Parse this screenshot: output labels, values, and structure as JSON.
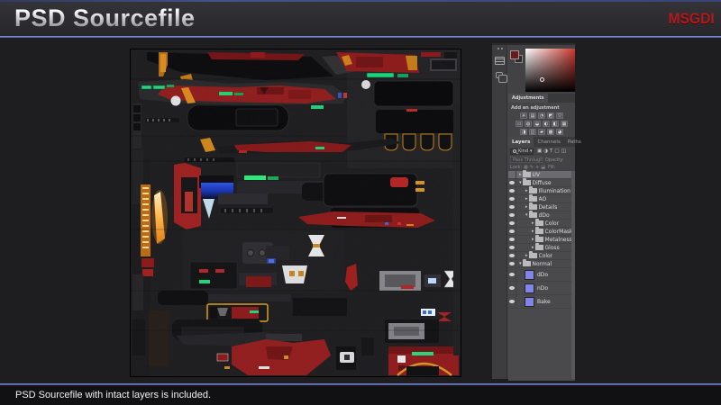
{
  "header": {
    "title": "PSD Sourcefile",
    "logo": "MSGDI"
  },
  "footer": {
    "caption": "PSD Sourcefile with intact layers is included."
  },
  "colors": {
    "accent_blue": "#5a6fc0",
    "logo_red": "#b01b1b",
    "layer_thumb_purple": "#8185e8",
    "picker_hue_red": "#c93a30",
    "slide_background": "#1e1e20"
  },
  "photoshop": {
    "adjustments": {
      "tab": "Adjustments",
      "label": "Add an adjustment",
      "icon_rows": [
        [
          "☀",
          "▤",
          "◔",
          "◩",
          "▽"
        ],
        [
          "▭",
          "◍",
          "◒",
          "◐",
          "◧",
          "▦"
        ],
        [
          "◨",
          "◫",
          "▰",
          "▩",
          "◕"
        ]
      ]
    },
    "tabs": [
      {
        "label": "Layers",
        "active": true
      },
      {
        "label": "Channels",
        "active": false
      },
      {
        "label": "Paths",
        "active": false
      }
    ],
    "filter": {
      "kind": "Kind",
      "caret": "▾",
      "icons": [
        "▣",
        "◑",
        "T",
        "▢",
        "◫"
      ]
    },
    "blend": {
      "mode": "Pass Through",
      "opacity_label": "Opacity:"
    },
    "lock": {
      "label": "Lock:",
      "icons": [
        "▦",
        "✎",
        "+",
        "⬓"
      ],
      "fill_label": "Fill:"
    },
    "layers": [
      {
        "name": "UV",
        "kind": "group",
        "indent": 0,
        "expanded": false,
        "visible": false,
        "selected": true
      },
      {
        "name": "Diffuse",
        "kind": "group",
        "indent": 0,
        "expanded": true,
        "visible": true,
        "selected": false
      },
      {
        "name": "Illumination",
        "kind": "group",
        "indent": 1,
        "expanded": false,
        "visible": true,
        "selected": false
      },
      {
        "name": "AO",
        "kind": "group",
        "indent": 1,
        "expanded": false,
        "visible": true,
        "selected": false
      },
      {
        "name": "Details",
        "kind": "group",
        "indent": 1,
        "expanded": false,
        "visible": true,
        "selected": false
      },
      {
        "name": "dDo",
        "kind": "group",
        "indent": 1,
        "expanded": true,
        "visible": true,
        "selected": false
      },
      {
        "name": "Color",
        "kind": "group",
        "indent": 2,
        "expanded": false,
        "visible": true,
        "selected": false
      },
      {
        "name": "ColorMasks",
        "kind": "group",
        "indent": 2,
        "expanded": false,
        "visible": true,
        "selected": false
      },
      {
        "name": "Metalness",
        "kind": "group",
        "indent": 2,
        "expanded": false,
        "visible": true,
        "selected": false
      },
      {
        "name": "Gloss",
        "kind": "group",
        "indent": 2,
        "expanded": false,
        "visible": true,
        "selected": false
      },
      {
        "name": "Color",
        "kind": "group",
        "indent": 1,
        "expanded": false,
        "visible": true,
        "selected": false
      },
      {
        "name": "Normal",
        "kind": "group",
        "indent": 0,
        "expanded": true,
        "visible": true,
        "selected": false
      },
      {
        "name": "dDo",
        "kind": "layer",
        "indent": 1,
        "visible": true,
        "selected": false
      },
      {
        "name": "nDo",
        "kind": "layer",
        "indent": 1,
        "visible": true,
        "selected": false
      },
      {
        "name": "Bake",
        "kind": "layer",
        "indent": 1,
        "visible": true,
        "selected": false
      }
    ]
  }
}
